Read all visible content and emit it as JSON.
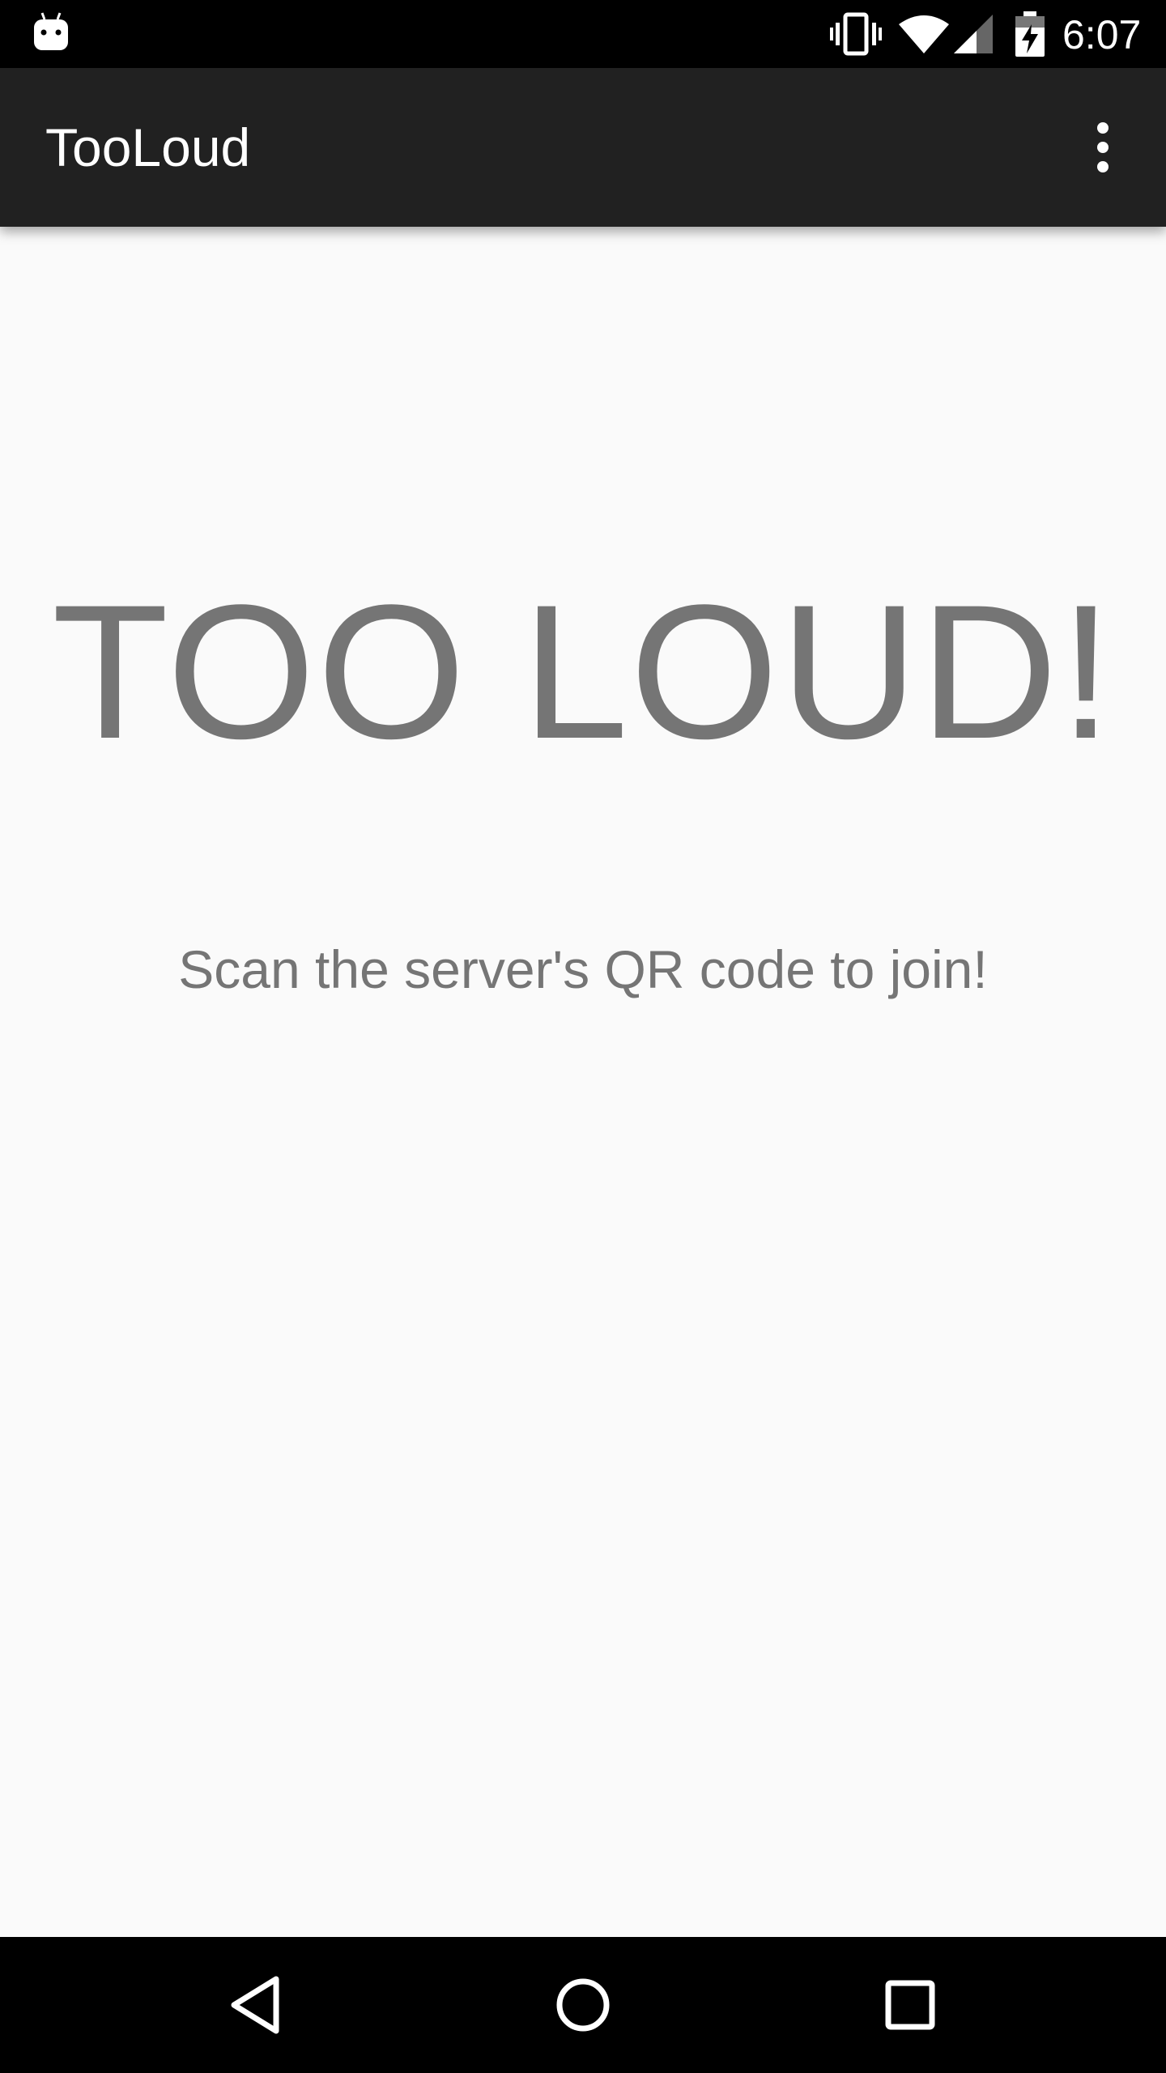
{
  "status_bar": {
    "time": "6:07",
    "icons": [
      "android-notification-icon",
      "vibrate-icon",
      "wifi-icon",
      "cell-signal-icon",
      "battery-charging-icon"
    ]
  },
  "app_bar": {
    "title": "TooLoud",
    "overflow_icon": "more-vert-icon"
  },
  "main": {
    "headline": "TOO LOUD!",
    "instruction": "Scan the server's QR code to join!",
    "text_color": "#757575"
  },
  "nav_bar": {
    "icons": [
      "back-icon",
      "home-icon",
      "recents-icon"
    ]
  },
  "colors": {
    "status_bar_bg": "#000000",
    "app_bar_bg": "#212121",
    "content_bg": "#fafafa",
    "text_secondary": "#757575"
  }
}
